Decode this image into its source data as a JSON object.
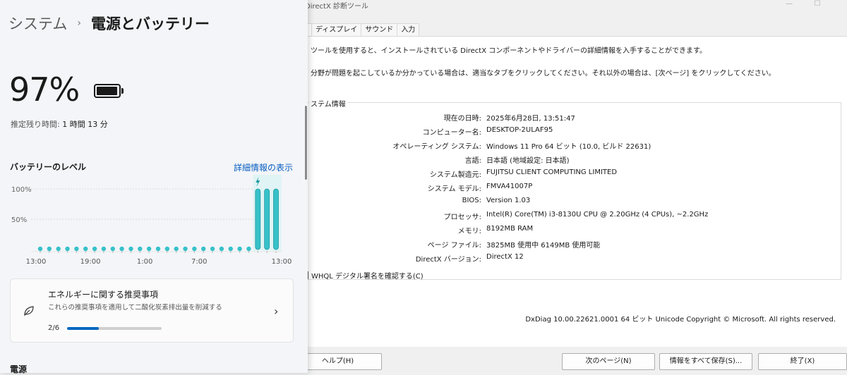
{
  "dxdiag": {
    "title": "DirectX 診断ツール",
    "win_min": "—",
    "win_max": "☐",
    "tabs": [
      "ム",
      "ディスプレイ",
      "サウンド",
      "入力"
    ],
    "desc1": "ツールを使用すると、インストールされている DirectX コンポーネントやドライバーの詳細情報を入手することができます。",
    "desc2": "分野が問題を起こしているか分かっている場合は、適当なタブをクリックしてください。それ以外の場合は、[次ページ] をクリックしてください。",
    "group_label": "ステム情報",
    "rows": [
      {
        "key": "現在の日時:",
        "value": "2025年6月28日, 13:51:47"
      },
      {
        "key": "コンピューター名:",
        "value": "DESKTOP-2ULAF95"
      },
      {
        "key": "オペレーティング システム:",
        "value": "Windows 11 Pro 64 ビット (10.0, ビルド 22631)"
      },
      {
        "key": "言語:",
        "value": "日本語 (地域設定: 日本語)"
      },
      {
        "key": "システム製造元:",
        "value": "FUJITSU CLIENT COMPUTING LIMITED"
      },
      {
        "key": "システム モデル:",
        "value": "FMVA41007P"
      },
      {
        "key": "BIOS:",
        "value": "Version 1.03"
      },
      {
        "key": "プロセッサ:",
        "value": "Intel(R) Core(TM) i3-8130U CPU @ 2.20GHz (4 CPUs), ~2.2GHz"
      },
      {
        "key": "メモリ:",
        "value": "8192MB RAM"
      },
      {
        "key": "ページ ファイル:",
        "value": "3825MB 使用中 6149MB 使用可能"
      },
      {
        "key": "DirectX バージョン:",
        "value": "DirectX 12"
      }
    ],
    "checkbox_label": "WHQL デジタル署名を確認する(C)",
    "version_line": "DxDiag 10.00.22621.0001 64 ビット Unicode  Copyright © Microsoft. All rights reserved.",
    "buttons": {
      "help": "ヘルプ(H)",
      "next": "次のページ(N)",
      "save": "情報をすべて保存(S)...",
      "exit": "終了(X)"
    }
  },
  "settings": {
    "breadcrumb_parent": "システム",
    "breadcrumb_sep": "›",
    "breadcrumb_current": "電源とバッテリー",
    "battery_percent": "97%",
    "battery_level": 0.97,
    "remaining_label": "推定残り時間: ",
    "remaining_value": "1 時間 13 分",
    "level_title": "バッテリーのレベル",
    "details_link": "詳細情報の表示",
    "recommend": {
      "title": "エネルギーに関する推奨事項",
      "subtitle": "これらの推奨事項を適用して二酸化炭素排出量を削減する",
      "progress_text": "2/6",
      "progress": 0.333
    },
    "power_section": "電源"
  },
  "chart_data": {
    "type": "bar",
    "title": "バッテリーのレベル",
    "ylim": [
      0,
      100
    ],
    "y_ticks": [
      "100%",
      "50%"
    ],
    "x_tick_labels": [
      "13:00",
      "19:00",
      "1:00",
      "7:00",
      "13:00"
    ],
    "charging_icon": "lightning-icon",
    "values": [
      0,
      0,
      0,
      0,
      0,
      0,
      0,
      0,
      0,
      0,
      0,
      0,
      0,
      0,
      0,
      0,
      0,
      0,
      0,
      0,
      0,
      0,
      0,
      0,
      100,
      100,
      100
    ],
    "colors": {
      "bar": "#37c1c9",
      "bar_stroke": "#1f9aa1",
      "empty_dot": "#37c1c9",
      "charging_band": "#e1f4f5"
    }
  }
}
